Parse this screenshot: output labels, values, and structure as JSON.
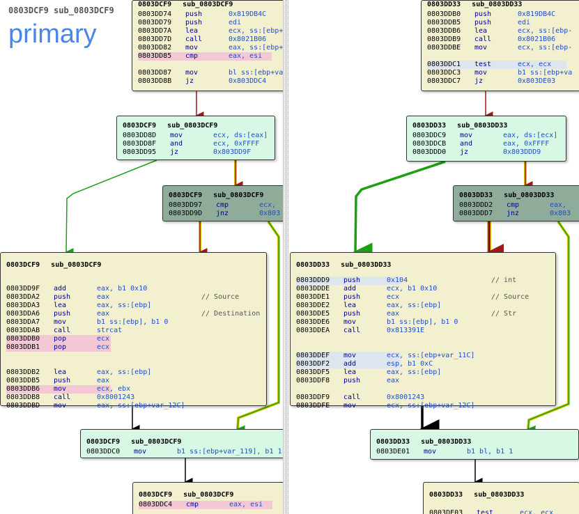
{
  "header": {
    "title": "0803DCF9 sub_0803DCF9",
    "label": "primary"
  },
  "colors": {
    "green_edge": "#1aa010",
    "red_edge": "#a01818",
    "true_edge": "#d4c800",
    "black_edge": "#000000"
  },
  "left": {
    "nodes": [
      {
        "id": "L1",
        "color": "yellow",
        "title_addr": "0803DCF9",
        "title_name": "sub_0803DCF9",
        "rows": [
          {
            "addr": "0803DD74",
            "mn": "push",
            "op": "0x819DB4C"
          },
          {
            "addr": "0803DD79",
            "mn": "push",
            "op": "edi"
          },
          {
            "addr": "0803DD7A",
            "mn": "lea",
            "op": "ecx, ss:[ebp+"
          },
          {
            "addr": "0803DD7D",
            "mn": "call",
            "op": "0x8021B06"
          },
          {
            "addr": "0803DD82",
            "mn": "mov",
            "op": "eax, ss:[ebp+"
          },
          {
            "addr": "0803DD85",
            "mn": "cmp",
            "op": "eax, esi",
            "hl": true
          },
          {
            "gap": true
          },
          {
            "addr": "0803DD87",
            "mn": "mov",
            "op": "bl ss:[ebp+var"
          },
          {
            "addr": "0803DD8B",
            "mn": "jz",
            "op": "0x803DDC4"
          }
        ]
      },
      {
        "id": "L2",
        "color": "green",
        "title_addr": "0803DCF9",
        "title_name": "sub_0803DCF9",
        "rows": [
          {
            "addr": "0803DD8D",
            "mn": "mov",
            "op": "ecx, ds:[eax]"
          },
          {
            "addr": "0803DD8F",
            "mn": "and",
            "op": "ecx, 0xFFFF"
          },
          {
            "addr": "0803DD95",
            "mn": "jz",
            "op": "0x803DD9F"
          }
        ]
      },
      {
        "id": "L3",
        "color": "dark",
        "title_addr": "0803DCF9",
        "title_name": "sub_0803DCF9",
        "rows": [
          {
            "addr": "0803DD97",
            "mn": "cmp",
            "op": "ecx,"
          },
          {
            "addr": "0803DD9D",
            "mn": "jnz",
            "op": "0x803"
          }
        ]
      },
      {
        "id": "L4",
        "color": "yellow",
        "title_addr": "0803DCF9",
        "title_name": "sub_0803DCF9",
        "rows": [
          {
            "gap": true
          },
          {
            "addr": "0803DD9F",
            "mn": "add",
            "op": "eax, b1 0x10"
          },
          {
            "addr": "0803DDA2",
            "mn": "push",
            "op": "eax",
            "cm": "// Source"
          },
          {
            "addr": "0803DDA3",
            "mn": "lea",
            "op": "eax, ss:[ebp]"
          },
          {
            "addr": "0803DDA6",
            "mn": "push",
            "op": "eax",
            "cm": "// Destination"
          },
          {
            "addr": "0803DDA7",
            "mn": "mov",
            "op": "b1 ss:[ebp], b1 0"
          },
          {
            "addr": "0803DDAB",
            "mn": "call",
            "op": "strcat"
          },
          {
            "addr": "0803DDB0",
            "mn": "pop",
            "op": "ecx",
            "hl": true
          },
          {
            "addr": "0803DDB1",
            "mn": "pop",
            "op": "ecx",
            "hl": true
          },
          {
            "gap": true
          },
          {
            "gap": true
          },
          {
            "addr": "0803DDB2",
            "mn": "lea",
            "op": "eax, ss:[ebp]"
          },
          {
            "addr": "0803DDB5",
            "mn": "push",
            "op": "eax"
          },
          {
            "addr": "0803DDB6",
            "mn": "mov",
            "op": "ecx, ebx",
            "hl": true
          },
          {
            "addr": "0803DDB8",
            "mn": "call",
            "op": "0x8001243"
          },
          {
            "addr": "0803DDBD",
            "mn": "mov",
            "op": "eax, ss:[ebp+var_12C]"
          }
        ]
      },
      {
        "id": "L5",
        "color": "green",
        "title_addr": "0803DCF9",
        "title_name": "sub_0803DCF9",
        "rows": [
          {
            "addr": "0803DDC0",
            "mn": "mov",
            "op": "b1 ss:[ebp+var_119], b1 1"
          }
        ]
      },
      {
        "id": "L6",
        "color": "yellow",
        "title_addr": "0803DCF9",
        "title_name": "sub_0803DCF9",
        "rows": [
          {
            "addr": "0803DDC4",
            "mn": "cmp",
            "op": "eax, esi",
            "hl": true
          }
        ]
      }
    ]
  },
  "right": {
    "nodes": [
      {
        "id": "R1",
        "color": "yellow",
        "title_addr": "0803DD33",
        "title_name": "sub_0803DD33",
        "rows": [
          {
            "addr": "0803DDB0",
            "mn": "push",
            "op": "0x819DB4C"
          },
          {
            "addr": "0803DDB5",
            "mn": "push",
            "op": "edi"
          },
          {
            "addr": "0803DDB6",
            "mn": "lea",
            "op": "ecx, ss:[ebp-"
          },
          {
            "addr": "0803DDB9",
            "mn": "call",
            "op": "0x8021B06"
          },
          {
            "addr": "0803DDBE",
            "mn": "mov",
            "op": "ecx, ss:[ebp-"
          },
          {
            "gap": true
          },
          {
            "addr": "0803DDC1",
            "mn": "test",
            "op": "ecx, ecx",
            "hlb": true
          },
          {
            "addr": "0803DDC3",
            "mn": "mov",
            "op": "b1 ss:[ebp+va"
          },
          {
            "addr": "0803DDC7",
            "mn": "jz",
            "op": "0x803DE03"
          }
        ]
      },
      {
        "id": "R2",
        "color": "green",
        "title_addr": "0803DD33",
        "title_name": "sub_0803DD33",
        "rows": [
          {
            "addr": "0803DDC9",
            "mn": "mov",
            "op": "eax, ds:[ecx]"
          },
          {
            "addr": "0803DDCB",
            "mn": "and",
            "op": "eax, 0xFFFF"
          },
          {
            "addr": "0803DDD0",
            "mn": "jz",
            "op": "0x803DDD9"
          }
        ]
      },
      {
        "id": "R3",
        "color": "dark",
        "title_addr": "0803DD33",
        "title_name": "sub_0803DD33",
        "rows": [
          {
            "addr": "0803DDD2",
            "mn": "cmp",
            "op": "eax,"
          },
          {
            "addr": "0803DDD7",
            "mn": "jnz",
            "op": "0x803"
          }
        ]
      },
      {
        "id": "R4",
        "color": "yellow",
        "title_addr": "0803DD33",
        "title_name": "sub_0803DD33",
        "rows": [
          {
            "addr": "0803DDD9",
            "mn": "push",
            "op": "0x104",
            "cm": "// int",
            "hlb": true
          },
          {
            "addr": "0803DDDE",
            "mn": "add",
            "op": "ecx, b1 0x10"
          },
          {
            "addr": "0803DDE1",
            "mn": "push",
            "op": "ecx",
            "cm": "// Source"
          },
          {
            "addr": "0803DDE2",
            "mn": "lea",
            "op": "eax, ss:[ebp]"
          },
          {
            "addr": "0803DDE5",
            "mn": "push",
            "op": "eax",
            "cm": "// Str"
          },
          {
            "addr": "0803DDE6",
            "mn": "mov",
            "op": "b1 ss:[ebp], b1 0"
          },
          {
            "addr": "0803DDEA",
            "mn": "call",
            "op": "0x813391E"
          },
          {
            "gap": true
          },
          {
            "gap": true
          },
          {
            "addr": "0803DDEF",
            "mn": "mov",
            "op": "ecx, ss:[ebp+var_11C]",
            "hlb": true
          },
          {
            "addr": "0803DDF2",
            "mn": "add",
            "op": "esp, b1 0xC",
            "hlb": true
          },
          {
            "addr": "0803DDF5",
            "mn": "lea",
            "op": "eax, ss:[ebp]"
          },
          {
            "addr": "0803DDF8",
            "mn": "push",
            "op": "eax"
          },
          {
            "gap": true
          },
          {
            "addr": "0803DDF9",
            "mn": "call",
            "op": "0x8001243"
          },
          {
            "addr": "0803DDFE",
            "mn": "mov",
            "op": "ecx, ss:[ebp+var_12C]"
          }
        ]
      },
      {
        "id": "R5",
        "color": "green",
        "title_addr": "0803DD33",
        "title_name": "sub_0803DD33",
        "rows": [
          {
            "addr": "0803DE01",
            "mn": "mov",
            "op": "b1 bl, b1 1"
          }
        ]
      },
      {
        "id": "R6",
        "color": "yellow",
        "title_addr": "0803DD33",
        "title_name": "sub_0803DD33",
        "rows": [
          {
            "gap": true
          },
          {
            "addr": "0803DE03",
            "mn": "test",
            "op": "ecx, ecx"
          }
        ]
      }
    ]
  }
}
